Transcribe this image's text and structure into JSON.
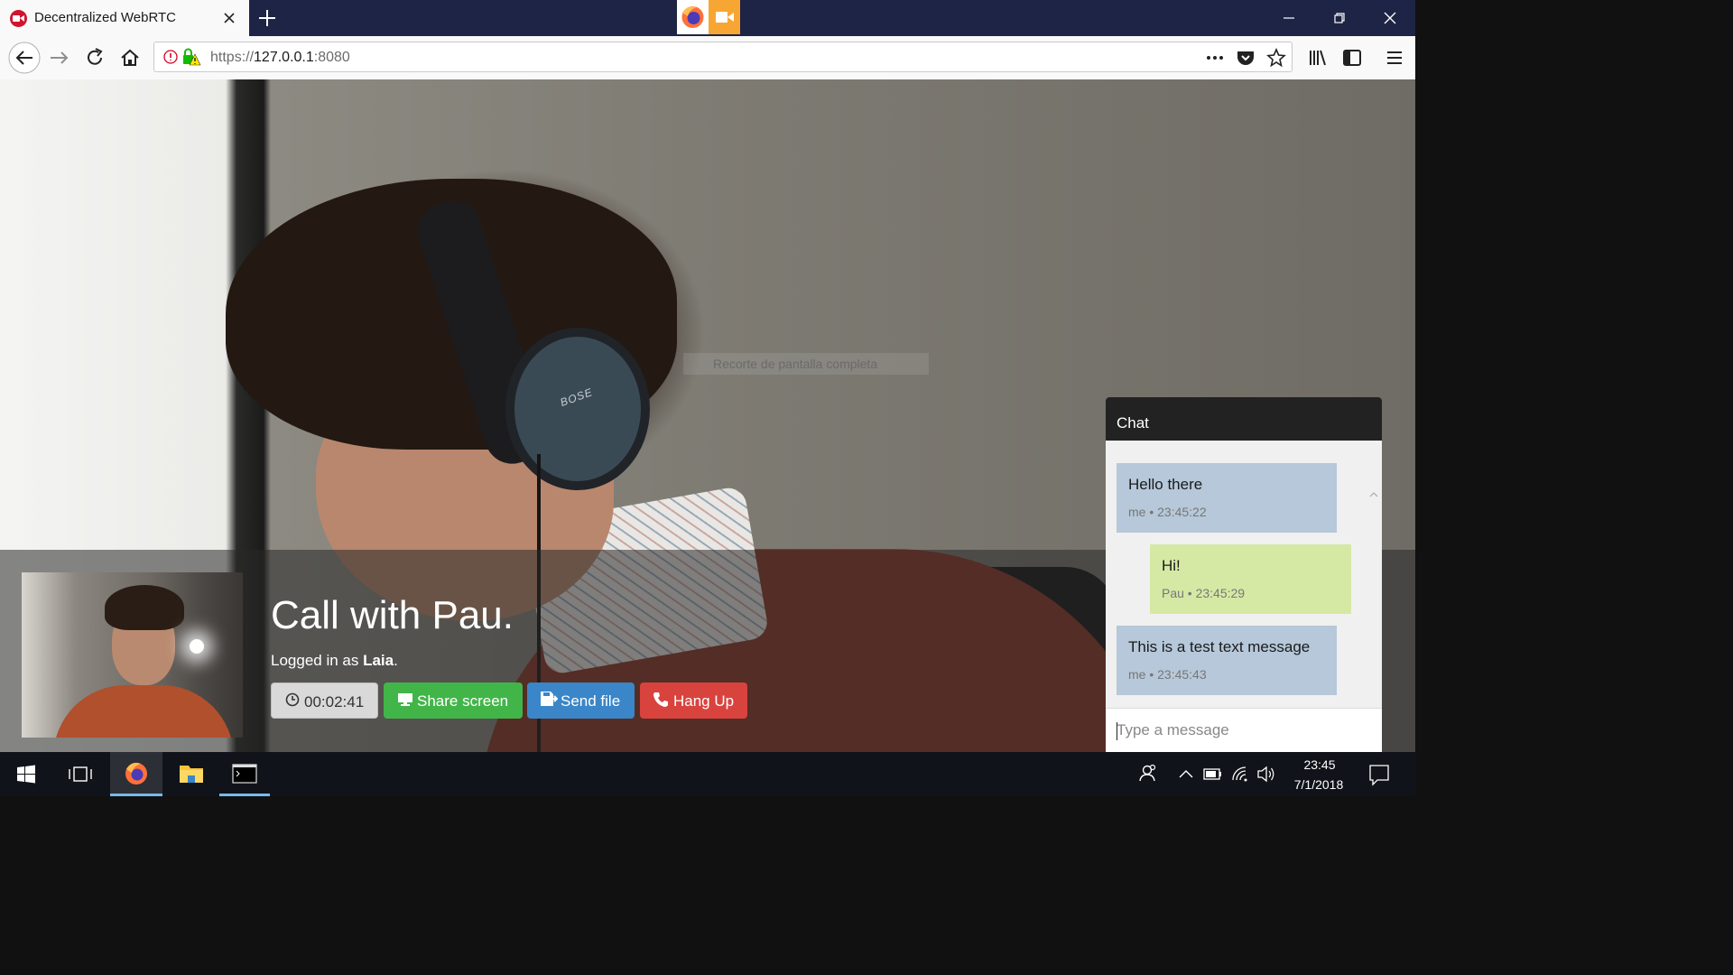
{
  "browser": {
    "tab_title": "Decentralized WebRTC",
    "url_prefix": "https://",
    "url_host": "127.0.0.1",
    "url_port": ":8080"
  },
  "overlay": {
    "snip_text": "Recorte de pantalla completa"
  },
  "remote_video": {
    "headphone_brand": "BOSE"
  },
  "call": {
    "title": "Call with Pau.",
    "logged_prefix": "Logged in as ",
    "user": "Laia",
    "logged_suffix": "."
  },
  "controls": {
    "timer": "00:02:41",
    "share_screen": "Share screen",
    "send_file": "Send file",
    "hang_up": "Hang Up",
    "colors": {
      "share": "#42b549",
      "send": "#3a86c8",
      "hang": "#d9433e",
      "timer": "#d9d9d9"
    }
  },
  "chat": {
    "title": "Chat",
    "messages": [
      {
        "text": "Hello there",
        "meta": "me • 23:45:22",
        "color": "#b6c8d9"
      },
      {
        "text": "Hi!",
        "meta": "Pau • 23:45:29",
        "color": "#d6e9a4"
      },
      {
        "text": "This is a test text message",
        "meta": "me • 23:45:43",
        "color": "#b6c8d9"
      }
    ],
    "input_placeholder": "Type a message"
  },
  "taskbar": {
    "time": "23:45",
    "date": "7/1/2018"
  }
}
